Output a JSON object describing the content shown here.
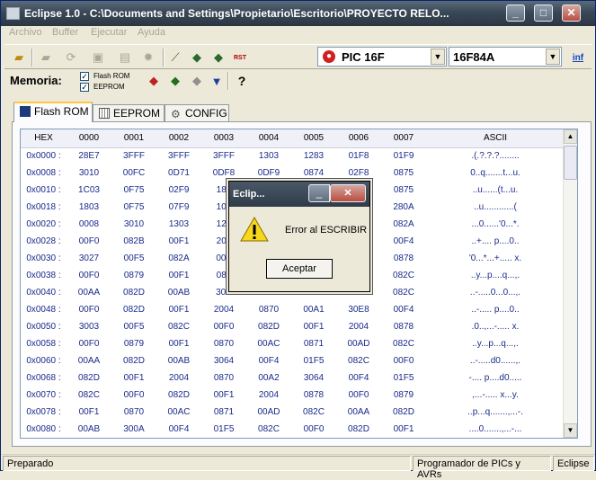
{
  "window": {
    "title": "Eclipse 1.0 - C:\\Documents and Settings\\Propietario\\Escritorio\\PROYECTO RELO..."
  },
  "titlebar_buttons": {
    "minimize": "_",
    "maximize": "□",
    "close": "✕"
  },
  "menu": [
    "Archivo",
    "Buffer",
    "Ejecutar",
    "Ayuda"
  ],
  "toolbar": {
    "device_family": "PIC 16F",
    "device_model": "16F84A",
    "rst_label": "RST",
    "info_label": "inf"
  },
  "memory": {
    "label": "Memoria:",
    "options": [
      {
        "label": "Flash ROM",
        "checked": true
      },
      {
        "label": "EEPROM",
        "checked": true
      }
    ],
    "help_label": "?"
  },
  "tabs": [
    {
      "label": "Flash ROM",
      "active": true
    },
    {
      "label": "EEPROM",
      "active": false
    },
    {
      "label": "CONFIG",
      "active": false
    }
  ],
  "table": {
    "headers": [
      "HEX",
      "0000",
      "0001",
      "0002",
      "0003",
      "0004",
      "0005",
      "0006",
      "0007",
      "ASCII"
    ],
    "rows": [
      [
        "0x0000 :",
        "28E7",
        "3FFF",
        "3FFF",
        "3FFF",
        "1303",
        "1283",
        "01F8",
        "01F9",
        ".(.?.?.?........"
      ],
      [
        "0x0008 :",
        "3010",
        "00FC",
        "0D71",
        "0DF8",
        "0DF9",
        "0874",
        "02F8",
        "0875",
        "0..q.......t...u."
      ],
      [
        "0x0010 :",
        "1C03",
        "0F75",
        "02F9",
        "180",
        "",
        "",
        "",
        "0875",
        "..u......(t...u."
      ],
      [
        "0x0018 :",
        "1803",
        "0F75",
        "07F9",
        "100",
        "",
        "",
        "",
        "280A",
        "..u............("
      ],
      [
        "0x0020 :",
        "0008",
        "3010",
        "1303",
        "128",
        "",
        "",
        "",
        "082A",
        "...0......'0...*."
      ],
      [
        "0x0028 :",
        "00F0",
        "082B",
        "00F1",
        "200",
        "",
        "",
        "",
        "00F4",
        "..+.... p....0.."
      ],
      [
        "0x0030 :",
        "3027",
        "00F5",
        "082A",
        "00F",
        "",
        "",
        "",
        "0878",
        "'0...*...+..... x."
      ],
      [
        "0x0038 :",
        "00F0",
        "0879",
        "00F1",
        "087",
        "",
        "",
        "",
        "082C",
        "..y...p....q...,."
      ],
      [
        "0x0040 :",
        "00AA",
        "082D",
        "00AB",
        "30E",
        "",
        "",
        "",
        "082C",
        "..-.....0...0...,."
      ],
      [
        "0x0048 :",
        "00F0",
        "082D",
        "00F1",
        "2004",
        "0870",
        "00A1",
        "30E8",
        "00F4",
        "..-..... p....0.."
      ],
      [
        "0x0050 :",
        "3003",
        "00F5",
        "082C",
        "00F0",
        "082D",
        "00F1",
        "2004",
        "0878",
        ".0..,...-..... x."
      ],
      [
        "0x0058 :",
        "00F0",
        "0879",
        "00F1",
        "0870",
        "00AC",
        "0871",
        "00AD",
        "082C",
        "..y...p...q...,."
      ],
      [
        "0x0060 :",
        "00AA",
        "082D",
        "00AB",
        "3064",
        "00F4",
        "01F5",
        "082C",
        "00F0",
        "..-.....d0......,."
      ],
      [
        "0x0068 :",
        "082D",
        "00F1",
        "2004",
        "0870",
        "00A2",
        "3064",
        "00F4",
        "01F5",
        "-.... p....d0....."
      ],
      [
        "0x0070 :",
        "082C",
        "00F0",
        "082D",
        "00F1",
        "2004",
        "0878",
        "00F0",
        "0879",
        ",...-..... x...y."
      ],
      [
        "0x0078 :",
        "00F1",
        "0870",
        "00AC",
        "0871",
        "00AD",
        "082C",
        "00AA",
        "082D",
        "..p...q.......,...-."
      ],
      [
        "0x0080 :",
        "00AB",
        "300A",
        "00F4",
        "01F5",
        "082C",
        "00F0",
        "082D",
        "00F1",
        "....0.......,...-..."
      ]
    ]
  },
  "status": {
    "left": "Preparado",
    "middle": "Programador de PICs y AVRs",
    "right": "Eclipse"
  },
  "dialog": {
    "title": "Eclip...",
    "close_label": "✕",
    "min_label": "_",
    "message": "Error al ESCRIBIR",
    "button": "Aceptar"
  }
}
